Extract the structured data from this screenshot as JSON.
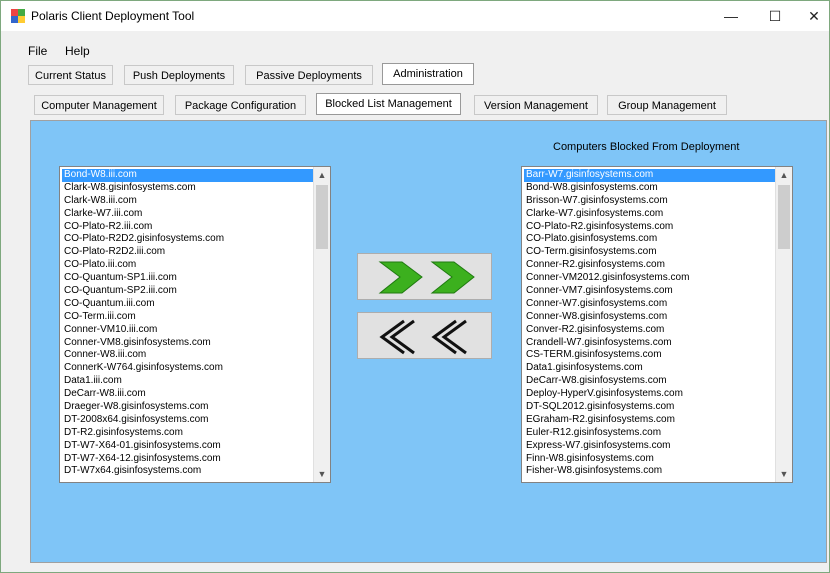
{
  "window": {
    "title": "Polaris Client Deployment Tool",
    "minimize": "—",
    "maximize": "☐",
    "close": "✕"
  },
  "menu": [
    "File",
    "Help"
  ],
  "main_tabs": [
    "Current Status",
    "Push Deployments",
    "Passive Deployments",
    "Administration"
  ],
  "sub_tabs": [
    "Computer Management",
    "Package Configuration",
    "Blocked List Management",
    "Version Management",
    "Group Management"
  ],
  "left_list": {
    "selected_index": 0,
    "items": [
      "Bond-W8.iii.com",
      "Clark-W8.gisinfosystems.com",
      "Clark-W8.iii.com",
      "Clarke-W7.iii.com",
      "CO-Plato-R2.iii.com",
      "CO-Plato-R2D2.gisinfosystems.com",
      "CO-Plato-R2D2.iii.com",
      "CO-Plato.iii.com",
      "CO-Quantum-SP1.iii.com",
      "CO-Quantum-SP2.iii.com",
      "CO-Quantum.iii.com",
      "CO-Term.iii.com",
      "Conner-VM10.iii.com",
      "Conner-VM8.gisinfosystems.com",
      "Conner-W8.iii.com",
      "ConnerK-W764.gisinfosystems.com",
      "Data1.iii.com",
      "DeCarr-W8.iii.com",
      "Draeger-W8.gisinfosystems.com",
      "DT-2008x64.gisinfosystems.com",
      "DT-R2.gisinfosystems.com",
      "DT-W7-X64-01.gisinfosystems.com",
      "DT-W7-X64-12.gisinfosystems.com",
      "DT-W7x64.gisinfosystems.com"
    ]
  },
  "right_list": {
    "heading": "Computers Blocked From Deployment",
    "selected_index": 0,
    "items": [
      "Barr-W7.gisinfosystems.com",
      "Bond-W8.gisinfosystems.com",
      "Brisson-W7.gisinfosystems.com",
      "Clarke-W7.gisinfosystems.com",
      "CO-Plato-R2.gisinfosystems.com",
      "CO-Plato.gisinfosystems.com",
      "CO-Term.gisinfosystems.com",
      "Conner-R2.gisinfosystems.com",
      "Conner-VM2012.gisinfosystems.com",
      "Conner-VM7.gisinfosystems.com",
      "Conner-W7.gisinfosystems.com",
      "Conner-W8.gisinfosystems.com",
      "Conver-R2.gisinfosystems.com",
      "Crandell-W7.gisinfosystems.com",
      "CS-TERM.gisinfosystems.com",
      "Data1.gisinfosystems.com",
      "DeCarr-W8.gisinfosystems.com",
      "Deploy-HyperV.gisinfosystems.com",
      "DT-SQL2012.gisinfosystems.com",
      "EGraham-R2.gisinfosystems.com",
      "Euler-R12.gisinfosystems.com",
      "Express-W7.gisinfosystems.com",
      "Finn-W8.gisinfosystems.com",
      "Fisher-W8.gisinfosystems.com"
    ]
  },
  "icons": {
    "add": "double-chevron-right-green",
    "remove": "double-chevron-left-black"
  },
  "colors": {
    "panel": "#7fc5f7",
    "selection": "#3399ff",
    "add_arrow": "#3cb01e"
  }
}
